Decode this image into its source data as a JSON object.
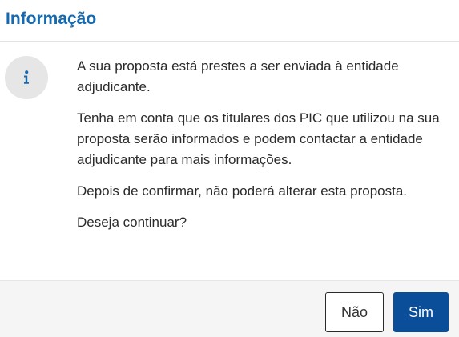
{
  "dialog": {
    "title": "Informação",
    "icon": "info-icon",
    "messages": [
      "A sua proposta está prestes a ser enviada à entidade adjudicante.",
      "Tenha em conta que os titulares dos PIC que utilizou na sua proposta serão informados e podem contactar a entidade adjudicante para mais informações.",
      "Depois de confirmar, não poderá alterar esta proposta.",
      "Deseja continuar?"
    ],
    "buttons": {
      "no_label": "Não",
      "yes_label": "Sim"
    }
  },
  "colors": {
    "title": "#1469b0",
    "primary_button": "#0a4d99",
    "icon_background": "#e6e6e6",
    "footer_background": "#f5f5f5"
  }
}
